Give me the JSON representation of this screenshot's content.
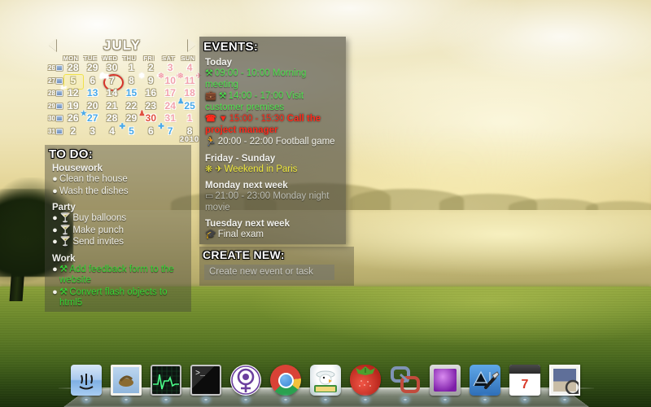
{
  "calendar": {
    "month": "JULY",
    "year": "2010",
    "prev_label": "◀",
    "next_label": "▶",
    "weekdays": [
      "MON",
      "TUE",
      "WED",
      "THU",
      "FRI",
      "SAT",
      "SUN"
    ],
    "week_numbers": [
      "26",
      "27",
      "28",
      "29",
      "30",
      "31"
    ],
    "weeks": [
      [
        {
          "d": "28",
          "color": "white"
        },
        {
          "d": "29",
          "color": "white"
        },
        {
          "d": "30",
          "color": "white"
        },
        {
          "d": "1",
          "color": "white"
        },
        {
          "d": "2",
          "color": "white"
        },
        {
          "d": "3",
          "color": "pink"
        },
        {
          "d": "4",
          "color": "pink"
        }
      ],
      [
        {
          "d": "5",
          "color": "white",
          "sel": true
        },
        {
          "d": "6",
          "color": "white"
        },
        {
          "d": "7",
          "color": "white",
          "today": true,
          "badge_tl": "🏍"
        },
        {
          "d": "8",
          "color": "white"
        },
        {
          "d": "9",
          "color": "white",
          "badge_tl": "❄",
          "badge_tr": "✈"
        },
        {
          "d": "10",
          "color": "pink",
          "badge_tl": "❄",
          "badge_tr": "✈"
        },
        {
          "d": "11",
          "color": "pink",
          "badge_tl": "❄",
          "badge_tr": "✈"
        }
      ],
      [
        {
          "d": "12",
          "color": "white",
          "badge_tl": "✂"
        },
        {
          "d": "13",
          "color": "blue"
        },
        {
          "d": "14",
          "color": "white"
        },
        {
          "d": "15",
          "color": "blue"
        },
        {
          "d": "16",
          "color": "white"
        },
        {
          "d": "17",
          "color": "pink"
        },
        {
          "d": "18",
          "color": "pink"
        }
      ],
      [
        {
          "d": "19",
          "color": "white"
        },
        {
          "d": "20",
          "color": "white"
        },
        {
          "d": "21",
          "color": "white"
        },
        {
          "d": "22",
          "color": "white"
        },
        {
          "d": "23",
          "color": "white"
        },
        {
          "d": "24",
          "color": "pink"
        },
        {
          "d": "25",
          "color": "blue",
          "badge_tl": "♟"
        }
      ],
      [
        {
          "d": "26",
          "color": "white"
        },
        {
          "d": "27",
          "color": "blue",
          "badge_tl": "★"
        },
        {
          "d": "28",
          "color": "white"
        },
        {
          "d": "29",
          "color": "white"
        },
        {
          "d": "30",
          "color": "red",
          "badge_tl": "♟"
        },
        {
          "d": "31",
          "color": "pink"
        },
        {
          "d": "1",
          "color": "pink"
        }
      ],
      [
        {
          "d": "2",
          "color": "white"
        },
        {
          "d": "3",
          "color": "white"
        },
        {
          "d": "4",
          "color": "white"
        },
        {
          "d": "5",
          "color": "blue",
          "badge_tl": "✚"
        },
        {
          "d": "6",
          "color": "white"
        },
        {
          "d": "7",
          "color": "blue",
          "badge_tl": "✚"
        },
        {
          "d": "8",
          "color": "white"
        }
      ]
    ]
  },
  "events": {
    "title": "EVENTS:",
    "groups": [
      {
        "day": "Today",
        "items": [
          {
            "icons": "⚒",
            "time": "09:00 - 10:00",
            "text": "Morning meeting",
            "color": "ev-green"
          },
          {
            "icons": "💼 ⚒",
            "time": "14:00 - 17:00",
            "text": "Visit customer premises",
            "color": "ev-green"
          },
          {
            "icons": "☎ ▼",
            "time": "15:00 - 15:30",
            "text": "Call the project manager",
            "color": "ev-red"
          },
          {
            "icons": "🏃",
            "time": "20:00 - 22:00",
            "text": "Football game",
            "color": "ev-white"
          }
        ]
      },
      {
        "day": "Friday - Sunday",
        "items": [
          {
            "icons": "❋ ✈",
            "time": "",
            "text": "Weekend in Paris",
            "color": "ev-yellow"
          }
        ]
      },
      {
        "day": "Monday next week",
        "items": [
          {
            "icons": "▭",
            "time": "21:00 - 23:00",
            "text": "Monday night movie",
            "color": "ev-grey"
          }
        ]
      },
      {
        "day": "Tuesday next week",
        "items": [
          {
            "icons": "🎓",
            "time": "",
            "text": "Final exam",
            "color": "ev-white"
          }
        ]
      }
    ]
  },
  "todo": {
    "title": "TO DO:",
    "groups": [
      {
        "name": "Housework",
        "items": [
          {
            "icon": "",
            "text": "Clean the house",
            "color": ""
          },
          {
            "icon": "",
            "text": "Wash the dishes",
            "color": ""
          }
        ]
      },
      {
        "name": "Party",
        "items": [
          {
            "icon": "🍸",
            "text": "Buy balloons",
            "color": ""
          },
          {
            "icon": "🍸",
            "text": "Make punch",
            "color": ""
          },
          {
            "icon": "🍸",
            "text": "Send invites",
            "color": ""
          }
        ]
      },
      {
        "name": "Work",
        "items": [
          {
            "icon": "⚒",
            "text": "Add feedback form to the website",
            "color": "td-green"
          },
          {
            "icon": "⚒",
            "text": "Convert flash objects to html5",
            "color": "td-green"
          }
        ]
      }
    ]
  },
  "create_new": {
    "title": "CREATE NEW:",
    "placeholder": "Create new event or task",
    "value": ""
  },
  "dock": {
    "items": [
      {
        "name": "finder",
        "label": "Finder"
      },
      {
        "name": "mail",
        "label": "Mail"
      },
      {
        "name": "activity-monitor",
        "label": "Activity Monitor"
      },
      {
        "name": "terminal",
        "label": "Terminal"
      },
      {
        "name": "venus-app",
        "label": "Venus"
      },
      {
        "name": "google-chrome",
        "label": "Google Chrome"
      },
      {
        "name": "chicken-vnc",
        "label": "Chicken of the VNC"
      },
      {
        "name": "strawberry-perl",
        "label": "Strawberry"
      },
      {
        "name": "virtualbox",
        "label": "VirtualBox"
      },
      {
        "name": "display-preferences",
        "label": "Display"
      },
      {
        "name": "xcode",
        "label": "Xcode"
      },
      {
        "name": "ical",
        "label": "iCal"
      },
      {
        "name": "preview-photo",
        "label": "Preview"
      }
    ],
    "ical_day": "7"
  },
  "colors": {
    "event_green": "#4fe24f",
    "event_red": "#ff2a1c",
    "event_yellow": "#efe93e",
    "event_grey": "#bfc0b6",
    "today_ring": "#d6332a",
    "selected_day": "#f0e24a",
    "weekend_pink": "#f2a3ad",
    "marked_blue": "#49a9e8"
  }
}
